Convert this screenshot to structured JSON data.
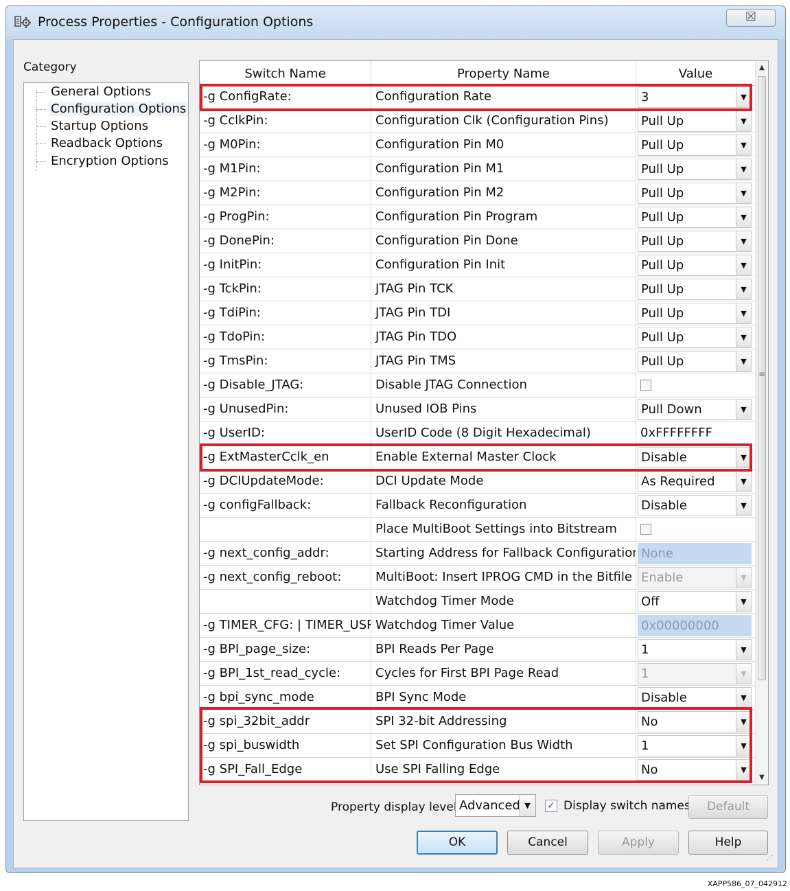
{
  "window": {
    "title": "Process Properties - Configuration Options",
    "close_glyph": "☒"
  },
  "category": {
    "label": "Category",
    "items": [
      {
        "label": "General Options",
        "selected": false
      },
      {
        "label": "Configuration Options",
        "selected": true
      },
      {
        "label": "Startup Options",
        "selected": false
      },
      {
        "label": "Readback Options",
        "selected": false
      },
      {
        "label": "Encryption Options",
        "selected": false
      }
    ]
  },
  "grid": {
    "headers": {
      "switch": "Switch Name",
      "property": "Property Name",
      "value": "Value"
    },
    "rows": [
      {
        "switch": "-g ConfigRate:",
        "property": "Configuration Rate",
        "value": "3",
        "kind": "dropdown"
      },
      {
        "switch": "-g CclkPin:",
        "property": "Configuration Clk (Configuration Pins)",
        "value": "Pull Up",
        "kind": "dropdown"
      },
      {
        "switch": "-g M0Pin:",
        "property": "Configuration Pin M0",
        "value": "Pull Up",
        "kind": "dropdown"
      },
      {
        "switch": "-g M1Pin:",
        "property": "Configuration Pin M1",
        "value": "Pull Up",
        "kind": "dropdown"
      },
      {
        "switch": "-g M2Pin:",
        "property": "Configuration Pin M2",
        "value": "Pull Up",
        "kind": "dropdown"
      },
      {
        "switch": "-g ProgPin:",
        "property": "Configuration Pin Program",
        "value": "Pull Up",
        "kind": "dropdown"
      },
      {
        "switch": "-g DonePin:",
        "property": "Configuration Pin Done",
        "value": "Pull Up",
        "kind": "dropdown"
      },
      {
        "switch": "-g InitPin:",
        "property": "Configuration Pin Init",
        "value": "Pull Up",
        "kind": "dropdown"
      },
      {
        "switch": "-g TckPin:",
        "property": "JTAG Pin TCK",
        "value": "Pull Up",
        "kind": "dropdown"
      },
      {
        "switch": "-g TdiPin:",
        "property": "JTAG Pin TDI",
        "value": "Pull Up",
        "kind": "dropdown"
      },
      {
        "switch": "-g TdoPin:",
        "property": "JTAG Pin TDO",
        "value": "Pull Up",
        "kind": "dropdown"
      },
      {
        "switch": "-g TmsPin:",
        "property": "JTAG Pin TMS",
        "value": "Pull Up",
        "kind": "dropdown"
      },
      {
        "switch": "-g Disable_JTAG:",
        "property": "Disable JTAG Connection",
        "value": "",
        "kind": "checkbox"
      },
      {
        "switch": "-g UnusedPin:",
        "property": "Unused IOB Pins",
        "value": "Pull Down",
        "kind": "dropdown"
      },
      {
        "switch": "-g UserID:",
        "property": "UserID Code (8 Digit Hexadecimal)",
        "value": "0xFFFFFFFF",
        "kind": "text"
      },
      {
        "switch": "-g ExtMasterCclk_en",
        "property": "Enable External Master Clock",
        "value": "Disable",
        "kind": "dropdown"
      },
      {
        "switch": "-g DCIUpdateMode:",
        "property": "DCI Update Mode",
        "value": "As Required",
        "kind": "dropdown"
      },
      {
        "switch": "-g configFallback:",
        "property": "Fallback Reconfiguration",
        "value": "Disable",
        "kind": "dropdown"
      },
      {
        "switch": "",
        "property": "Place MultiBoot Settings into Bitstream",
        "value": "",
        "kind": "checkbox"
      },
      {
        "switch": "-g next_config_addr:",
        "property": "Starting Address for Fallback Configuration",
        "value": "None",
        "kind": "shaded"
      },
      {
        "switch": "-g next_config_reboot:",
        "property": "MultiBoot: Insert IPROG CMD in the Bitfile",
        "value": "Enable",
        "kind": "dropdown-disabled"
      },
      {
        "switch": "",
        "property": "Watchdog Timer Mode",
        "value": "Off",
        "kind": "dropdown"
      },
      {
        "switch": "-g TIMER_CFG: | TIMER_USR:",
        "property": "Watchdog Timer Value",
        "value": "0x00000000",
        "kind": "shaded"
      },
      {
        "switch": "-g BPI_page_size:",
        "property": "BPI Reads Per Page",
        "value": "1",
        "kind": "dropdown"
      },
      {
        "switch": "-g BPI_1st_read_cycle:",
        "property": "Cycles for First BPI Page Read",
        "value": "1",
        "kind": "dropdown-disabled"
      },
      {
        "switch": "-g bpi_sync_mode",
        "property": "BPI Sync Mode",
        "value": "Disable",
        "kind": "dropdown"
      },
      {
        "switch": "-g spi_32bit_addr",
        "property": "SPI 32-bit Addressing",
        "value": "No",
        "kind": "dropdown"
      },
      {
        "switch": "-g spi_buswidth",
        "property": "Set SPI Configuration Bus Width",
        "value": "1",
        "kind": "dropdown"
      },
      {
        "switch": "-g SPI_Fall_Edge",
        "property": "Use SPI Falling Edge",
        "value": "No",
        "kind": "dropdown"
      }
    ]
  },
  "highlight_color": "#d6202a",
  "footer": {
    "display_level_label": "Property display level:",
    "display_level_value": "Advanced",
    "display_switch_names_label": "Display switch names",
    "display_switch_names_checked": true,
    "default_button": "Default",
    "ok_button": "OK",
    "cancel_button": "Cancel",
    "apply_button": "Apply",
    "help_button": "Help"
  },
  "figure_id": "XAPP586_07_042912"
}
